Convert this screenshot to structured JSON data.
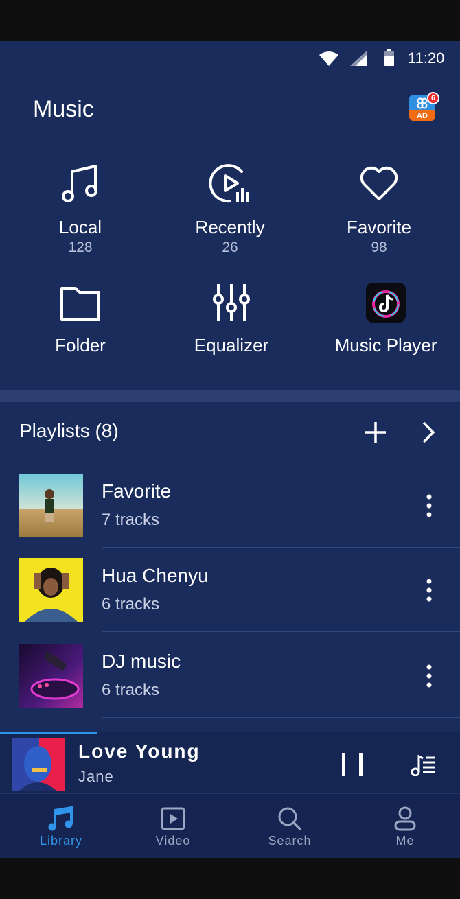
{
  "status_bar": {
    "time": "11:20"
  },
  "header": {
    "title": "Music",
    "ad_label": "AD",
    "ad_badge": "6"
  },
  "grid": [
    {
      "label": "Local",
      "count": "128",
      "icon": "music-note-icon"
    },
    {
      "label": "Recently",
      "count": "26",
      "icon": "recent-play-icon"
    },
    {
      "label": "Favorite",
      "count": "98",
      "icon": "heart-icon"
    },
    {
      "label": "Folder",
      "icon": "folder-icon"
    },
    {
      "label": "Equalizer",
      "icon": "equalizer-icon"
    },
    {
      "label": "Music Player",
      "icon": "tiktok-app-icon"
    }
  ],
  "playlists": {
    "header": "Playlists (8)",
    "items": [
      {
        "name": "Favorite",
        "count": "7 tracks"
      },
      {
        "name": "Hua Chenyu",
        "count": "6 tracks"
      },
      {
        "name": "DJ music",
        "count": "6 tracks"
      }
    ]
  },
  "now_playing": {
    "title": "Love Young",
    "artist": "Jane",
    "progress": 0.21
  },
  "bottom_nav": [
    {
      "label": "Library",
      "icon": "music-note-icon",
      "active": true
    },
    {
      "label": "Video",
      "icon": "video-icon",
      "active": false
    },
    {
      "label": "Search",
      "icon": "search-icon",
      "active": false
    },
    {
      "label": "Me",
      "icon": "person-icon",
      "active": false
    }
  ],
  "colors": {
    "background": "#1a2c5c",
    "accent": "#2f95ea",
    "divider": "#2c3f70"
  }
}
